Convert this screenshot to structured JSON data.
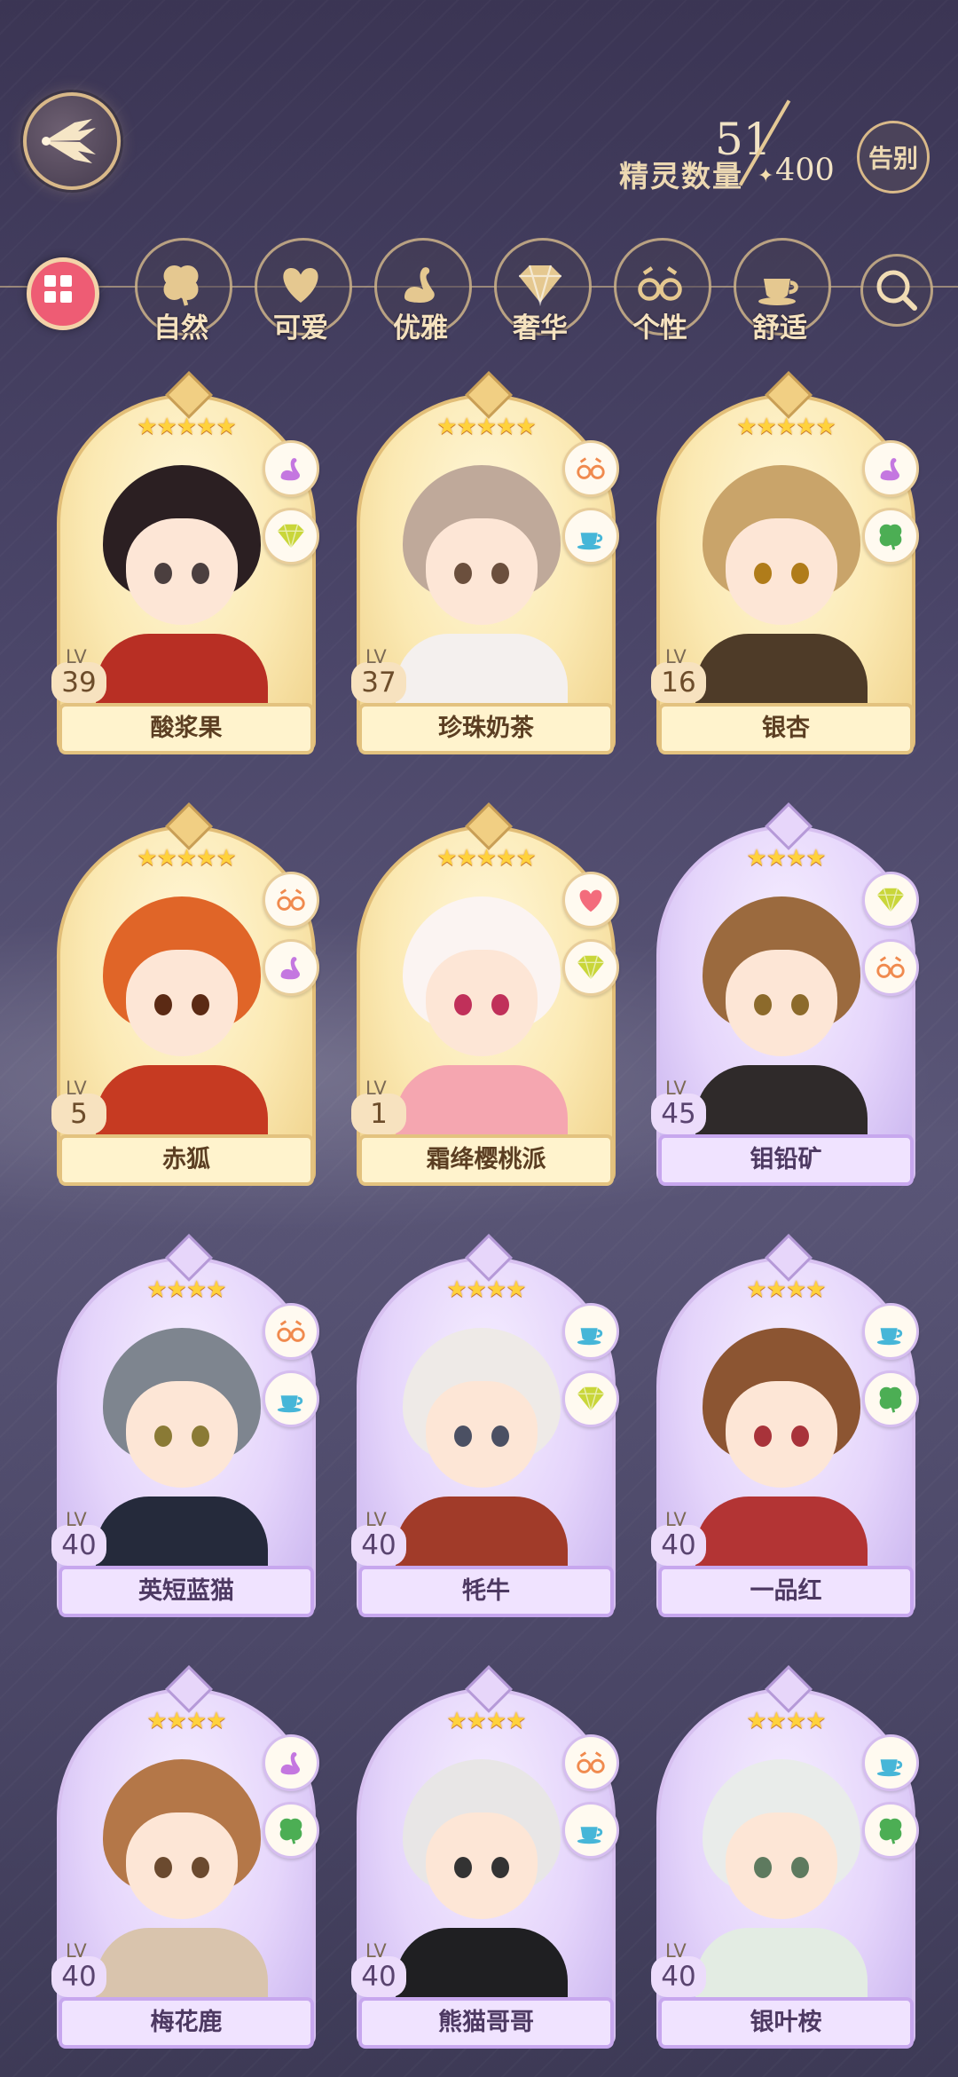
{
  "header": {
    "spirit_count_label": "精灵数量",
    "current_count": "51",
    "max_count": "400",
    "farewell_button": "告别"
  },
  "filters": [
    {
      "label": "自然",
      "icon": "clover-icon"
    },
    {
      "label": "可爱",
      "icon": "heart-icon"
    },
    {
      "label": "优雅",
      "icon": "swan-icon"
    },
    {
      "label": "奢华",
      "icon": "diamond-icon"
    },
    {
      "label": "个性",
      "icon": "glasses-icon"
    },
    {
      "label": "舒适",
      "icon": "teacup-icon"
    }
  ],
  "cards": [
    {
      "name": "酸浆果",
      "level": "39",
      "stars": 5,
      "rarity": "gold",
      "traits": [
        "swan-icon",
        "diamond-icon"
      ]
    },
    {
      "name": "珍珠奶茶",
      "level": "37",
      "stars": 5,
      "rarity": "gold",
      "traits": [
        "glasses-icon",
        "teacup-icon"
      ]
    },
    {
      "name": "银杏",
      "level": "16",
      "stars": 5,
      "rarity": "gold",
      "traits": [
        "swan-icon",
        "clover-icon"
      ]
    },
    {
      "name": "赤狐",
      "level": "5",
      "stars": 5,
      "rarity": "gold",
      "traits": [
        "glasses-icon",
        "swan-icon"
      ]
    },
    {
      "name": "霜绛樱桃派",
      "level": "1",
      "stars": 5,
      "rarity": "gold",
      "traits": [
        "heart-icon",
        "diamond-icon"
      ]
    },
    {
      "name": "钼铅矿",
      "level": "45",
      "stars": 4,
      "rarity": "purple",
      "traits": [
        "diamond-icon",
        "glasses-icon"
      ]
    },
    {
      "name": "英短蓝猫",
      "level": "40",
      "stars": 4,
      "rarity": "purple",
      "traits": [
        "glasses-icon",
        "teacup-icon"
      ]
    },
    {
      "name": "牦牛",
      "level": "40",
      "stars": 4,
      "rarity": "purple",
      "traits": [
        "teacup-icon",
        "diamond-icon"
      ]
    },
    {
      "name": "一品红",
      "level": "40",
      "stars": 4,
      "rarity": "purple",
      "traits": [
        "teacup-icon",
        "clover-icon"
      ]
    },
    {
      "name": "梅花鹿",
      "level": "40",
      "stars": 4,
      "rarity": "purple",
      "traits": [
        "swan-icon",
        "clover-icon"
      ]
    },
    {
      "name": "熊猫哥哥",
      "level": "40",
      "stars": 4,
      "rarity": "purple",
      "traits": [
        "glasses-icon",
        "teacup-icon"
      ]
    },
    {
      "name": "银叶桉",
      "level": "40",
      "stars": 4,
      "rarity": "purple",
      "traits": [
        "teacup-icon",
        "clover-icon"
      ]
    }
  ],
  "lv_label": "LV",
  "colors": {
    "background": "#4a4568",
    "gold_accent": "#e2be78",
    "filter_active": "#ee5c74",
    "star": "#ffd23c"
  }
}
